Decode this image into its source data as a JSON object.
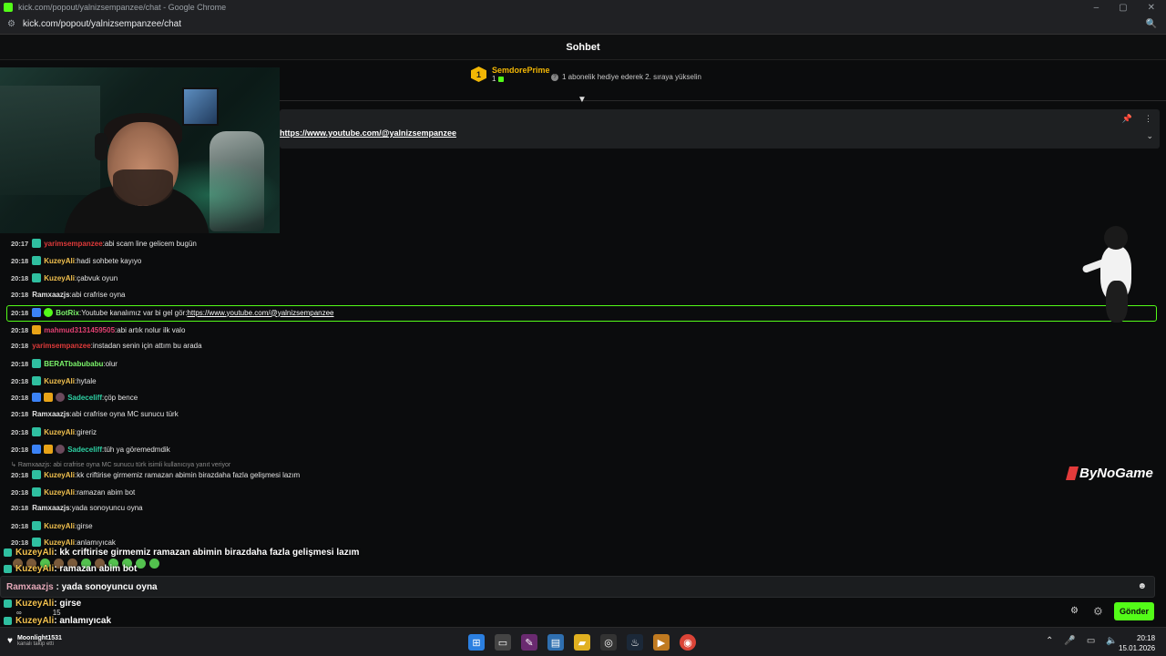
{
  "window": {
    "title": "kick.com/popout/yalnizsempanzee/chat - Google Chrome",
    "url": "kick.com/popout/yalnizsempanzee/chat",
    "controls": [
      "–",
      "▢",
      "✕"
    ]
  },
  "header": {
    "title": "Sohbet"
  },
  "top_supporter": {
    "rank": "1",
    "name": "SemdorePrime",
    "count": "1"
  },
  "gift_note": "1 abonelik hediye ederek 2. sıraya yükselin",
  "pinned": {
    "link": "https://www.youtube.com/@yalnizsempanzee"
  },
  "messages": [
    {
      "time": "20:17",
      "user": "yarimsempanzee",
      "sep": ": ",
      "text": "abi scam line gelicem bugün"
    },
    {
      "time": "20:18",
      "user": "KuzeyAli",
      "sep": ": ",
      "text": "hadi sohbete kayıyo"
    },
    {
      "time": "20:18",
      "user": "KuzeyAli",
      "sep": ": ",
      "text": "çabvuk oyun"
    },
    {
      "time": "20:18",
      "user": "Ramxaazjs",
      "sep": ": ",
      "text": "abi crafrise oyna"
    },
    {
      "time": "20:18",
      "user": "BotRix",
      "sep": ": ",
      "text": "Youtube kanalımız var bi gel gör: ",
      "link": "https://www.youtube.com/@yalnizsempanzee"
    },
    {
      "time": "20:18",
      "user": "mahmud3131459505",
      "sep": ": ",
      "text": "abi artık nolur ilk valo"
    },
    {
      "time": "20:18",
      "user": "yarimsempanzee",
      "sep": ": ",
      "text": "instadan senin için attım bu arada"
    },
    {
      "time": "20:18",
      "user": "BERATbabubabu",
      "sep": ": ",
      "text": "olur"
    },
    {
      "time": "20:18",
      "user": "KuzeyAli",
      "sep": ": ",
      "text": "hytale"
    },
    {
      "time": "20:18",
      "user": "Sadeceliff",
      "sep": ": ",
      "text": "çöp bence"
    },
    {
      "time": "20:18",
      "user": "Ramxaazjs",
      "sep": ": ",
      "text": "abi crafrise oyna MC sunucu türk"
    },
    {
      "time": "20:18",
      "user": "KuzeyAli",
      "sep": ": ",
      "text": "gireriz"
    },
    {
      "time": "20:18",
      "user": "Sadeceliff",
      "sep": ": ",
      "text": "tüh ya göremedmdik"
    },
    {
      "time": "20:18",
      "user": "KuzeyAli",
      "sep": ": ",
      "text": "kk criftirise girmemiz ramazan abimin birazdaha fazla gelişmesi lazım"
    },
    {
      "time": "20:18",
      "user": "KuzeyAli",
      "sep": ": ",
      "text": "ramazan abim bot"
    },
    {
      "time": "20:18",
      "user": "Ramxaazjs",
      "sep": ": ",
      "text": "yada sonoyuncu oyna"
    },
    {
      "time": "20:18",
      "user": "KuzeyAli",
      "sep": ": ",
      "text": "girse"
    },
    {
      "time": "20:18",
      "user": "KuzeyAli",
      "sep": ": ",
      "text": "anlamıyıcak"
    }
  ],
  "reply_note": "Ramxaazjs: abi crafrise oyna MC sunucu türk isimli kullanıcıya yanıt veriyor",
  "overlay": [
    {
      "user": "KuzeyAli",
      "text": " : kk criftirise girmemiz ramazan abimin birazdaha fazla gelişmesi lazım"
    },
    {
      "user": "KuzeyAli",
      "text": " : ramazan abim bot"
    },
    {
      "user": "KuzeyAli",
      "text": " : girse"
    },
    {
      "user": "KuzeyAli",
      "text": " : anlamıyıcak"
    }
  ],
  "input": {
    "user": "Ramxaazjs",
    "text": " : yada sonoyuncu oyna"
  },
  "stats": {
    "viewers": "∞",
    "count": "15"
  },
  "send_label": "Gönder",
  "brand": "ByNoGame",
  "taskbar": {
    "user": "Moonlight1531",
    "user_sub": "kanalı takip etti",
    "time": "20:18",
    "date": "15.01.2026"
  },
  "colors": {
    "accent": "#53fc18",
    "supporter": "#f2b705"
  }
}
